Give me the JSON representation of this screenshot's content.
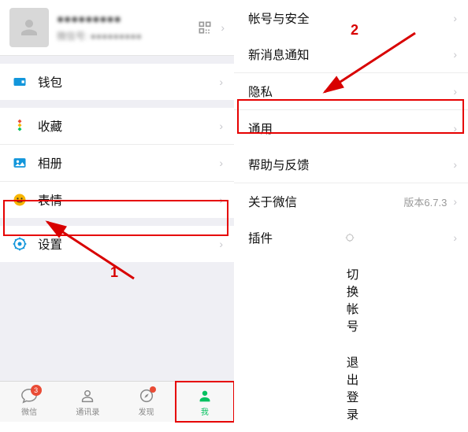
{
  "profile": {
    "name": "●●●●●●●●●",
    "id": "微信号: ●●●●●●●●●"
  },
  "left": {
    "wallet": "钱包",
    "favorites": "收藏",
    "album": "相册",
    "emoji": "表情",
    "settings": "设置"
  },
  "right": {
    "account_security": "帐号与安全",
    "new_msg_notify": "新消息通知",
    "privacy": "隐私",
    "general": "通用",
    "help_feedback": "帮助与反馈",
    "about": "关于微信",
    "about_version": "版本6.7.3",
    "plugins": "插件",
    "switch_account": "切换帐号",
    "logout": "退出登录"
  },
  "tabs": {
    "chat": "微信",
    "contacts": "通讯录",
    "discover": "发现",
    "me": "我",
    "chat_badge": "3"
  },
  "annotations": {
    "step1": "1",
    "step2": "2"
  }
}
